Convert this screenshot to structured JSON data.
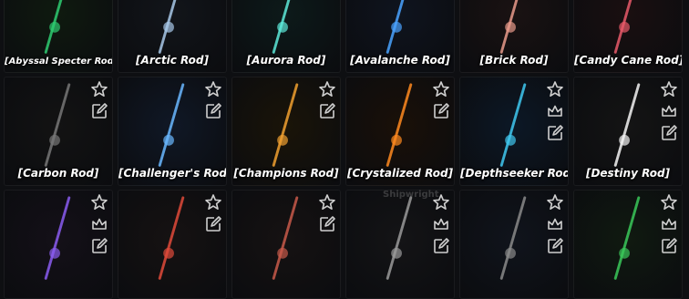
{
  "watermark": "Shipwright",
  "rods": [
    {
      "name": "[Abyssal Specter Rod]",
      "small": true,
      "bg": "#0f1a0f",
      "color": "#2ecc71",
      "icons": [
        "edit"
      ]
    },
    {
      "name": "[Arctic Rod]",
      "bg": "#12151a",
      "color": "#a8c8e8",
      "icons": [
        "edit"
      ]
    },
    {
      "name": "[Aurora Rod]",
      "bg": "#0d1a1a",
      "color": "#5de8d8",
      "icons": [
        "edit"
      ]
    },
    {
      "name": "[Avalanche Rod]",
      "bg": "#0f141f",
      "color": "#4aa3ff",
      "icons": [
        "edit"
      ]
    },
    {
      "name": "[Brick Rod]",
      "bg": "#1a1212",
      "color": "#e89a8a",
      "icons": [
        "edit"
      ]
    },
    {
      "name": "[Candy Cane Rod]",
      "bg": "#1a0f10",
      "color": "#e85a6a",
      "icons": [
        "edit"
      ]
    },
    {
      "name": "[Carbon Rod]",
      "bg": "#131313",
      "color": "#777777",
      "icons": [
        "star",
        "edit"
      ]
    },
    {
      "name": "[Challenger's Rod]",
      "bg": "#101826",
      "color": "#6ab8ff",
      "icons": [
        "star",
        "edit"
      ]
    },
    {
      "name": "[Champions Rod]",
      "bg": "#1a1408",
      "color": "#f0a030",
      "icons": [
        "star",
        "edit"
      ]
    },
    {
      "name": "[Crystalized Rod]",
      "bg": "#1a1008",
      "color": "#ff8a20",
      "icons": [
        "star",
        "edit"
      ]
    },
    {
      "name": "[Depthseeker Rod]",
      "bg": "#0c1826",
      "color": "#40c8f0",
      "icons": [
        "star",
        "crown",
        "edit"
      ]
    },
    {
      "name": "[Destiny Rod]",
      "bg": "#141414",
      "color": "#f4f4f4",
      "icons": [
        "star",
        "crown",
        "edit"
      ]
    },
    {
      "name": "",
      "bg": "#141018",
      "color": "#8a5cf0",
      "icons": [
        "star",
        "crown",
        "edit"
      ]
    },
    {
      "name": "",
      "bg": "#161212",
      "color": "#e04a3a",
      "icons": [
        "star",
        "edit"
      ]
    },
    {
      "name": "",
      "bg": "#161212",
      "color": "#c85a4a",
      "icons": [
        "star",
        "edit"
      ]
    },
    {
      "name": "",
      "bg": "#141416",
      "color": "#9a9a9a",
      "icons": [
        "star",
        "crown",
        "edit"
      ]
    },
    {
      "name": "",
      "bg": "#10141c",
      "color": "#8a8a8a",
      "icons": [
        "star",
        "crown",
        "edit"
      ]
    },
    {
      "name": "",
      "bg": "#101a10",
      "color": "#3ac85a",
      "icons": [
        "star",
        "crown",
        "edit"
      ]
    }
  ]
}
